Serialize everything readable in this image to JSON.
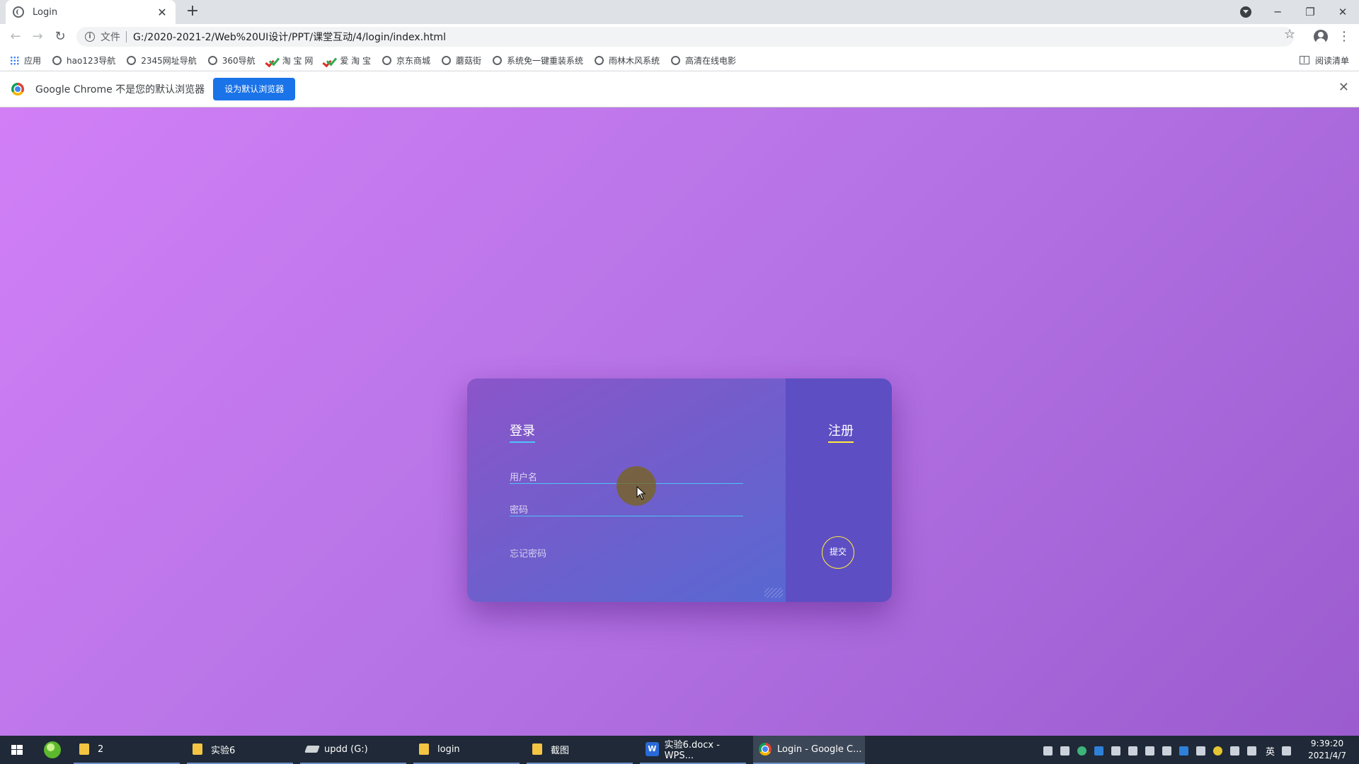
{
  "browser": {
    "tab_title": "Login",
    "tab_close": "✕",
    "new_tab": "+",
    "window_controls": {
      "minimize": "─",
      "restore": "❐",
      "close": "✕"
    },
    "nav": {
      "back": "←",
      "forward": "→",
      "reload": "↻"
    },
    "address": {
      "scheme": "文件",
      "url": "G:/2020-2021-2/Web%20UI设计/PPT/课堂互动/4/login/index.html"
    },
    "star": "☆",
    "menu": "⋮"
  },
  "bookmarks": {
    "apps": "应用",
    "items": [
      "hao123导航",
      "2345网址导航",
      "360导航",
      "淘 宝 网",
      "爱 淘 宝",
      "京东商城",
      "蘑菇街",
      "系统免一键重装系统",
      "雨林木风系统",
      "高清在线电影"
    ],
    "reading_list": "阅读清单"
  },
  "infobar": {
    "message": "Google Chrome 不是您的默认浏览器",
    "button": "设为默认浏览器",
    "close": "✕"
  },
  "login_card": {
    "login_title": "登录",
    "register_title": "注册",
    "username_placeholder": "用户名",
    "password_placeholder": "密码",
    "forgot_password": "忘记密码",
    "submit": "提交",
    "accent_login": "#4fc3f7",
    "accent_register": "#ffeb3b"
  },
  "taskbar": {
    "tasks": [
      "2",
      "实验6",
      "updd (G:)",
      "login",
      "截图",
      "实验6.docx - WPS...",
      "Login - Google C..."
    ],
    "wps_glyph": "W",
    "ime": "英",
    "time": "9:39:20",
    "date": "2021/4/7"
  }
}
